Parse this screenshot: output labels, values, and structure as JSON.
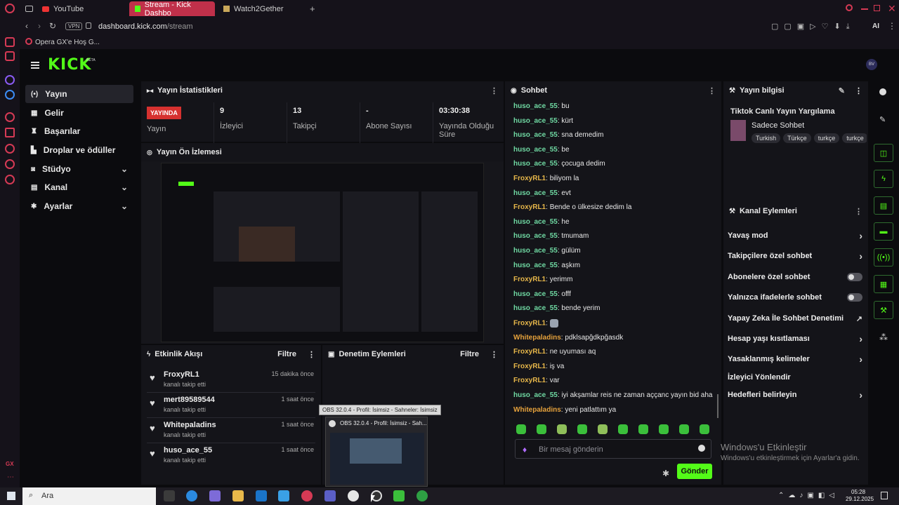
{
  "browser": {
    "tabs": [
      {
        "label": "YouTube",
        "active": false
      },
      {
        "label": "Stream - Kick Dashbo",
        "active": true
      },
      {
        "label": "Watch2Gether",
        "active": false
      }
    ],
    "vpn": "VPN",
    "url_domain": "dashboard.kick.com",
    "url_path": "/stream",
    "ai_label": "AI",
    "bookmark": "Opera GX'e Hoş G...",
    "gx_label": "GX"
  },
  "app": {
    "logo": "KICK",
    "logo_badge": "BETA",
    "avatar_label": "BV"
  },
  "sidebar": {
    "items": [
      {
        "label": "Yayın",
        "icon": "broadcast-icon",
        "active": true,
        "expandable": false
      },
      {
        "label": "Gelir",
        "icon": "revenue-icon",
        "active": false,
        "expandable": false
      },
      {
        "label": "Başarılar",
        "icon": "trophy-icon",
        "active": false,
        "expandable": false
      },
      {
        "label": "Droplar ve ödüller",
        "icon": "gift-icon",
        "active": false,
        "expandable": false
      },
      {
        "label": "Stüdyo",
        "icon": "studio-icon",
        "active": false,
        "expandable": true
      },
      {
        "label": "Kanal",
        "icon": "channel-icon",
        "active": false,
        "expandable": true
      },
      {
        "label": "Ayarlar",
        "icon": "gear-icon",
        "active": false,
        "expandable": true
      }
    ]
  },
  "stats": {
    "title": "Yayın İstatistikleri",
    "live_badge": "YAYINDA",
    "items": [
      {
        "value": "",
        "label": "Yayın"
      },
      {
        "value": "9",
        "label": "İzleyici"
      },
      {
        "value": "13",
        "label": "Takipçi"
      },
      {
        "value": "-",
        "label": "Abone Sayısı"
      },
      {
        "value": "03:30:38",
        "label": "Yayında Olduğu Süre"
      }
    ]
  },
  "preview": {
    "title": "Yayın Ön İzlemesi"
  },
  "events": {
    "title": "Etkinlik Akışı",
    "filter": "Filtre",
    "rows": [
      {
        "name": "FroxyRL1",
        "sub": "kanalı takip etti",
        "time": "15 dakika önce"
      },
      {
        "name": "mert89589544",
        "sub": "kanalı takip etti",
        "time": "1 saat önce"
      },
      {
        "name": "Whitepaladins",
        "sub": "kanalı takip etti",
        "time": "1 saat önce"
      },
      {
        "name": "huso_ace_55",
        "sub": "kanalı takip etti",
        "time": "1 saat önce"
      }
    ]
  },
  "moderation": {
    "title": "Denetim Eylemleri",
    "filter": "Filtre"
  },
  "obs": {
    "tooltip": "OBS 32.0.4 - Profil: İsimsiz - Sahneler: İsimsiz",
    "window_title": "OBS 32.0.4 - Profil: İsimsiz - Sah..."
  },
  "chat": {
    "title": "Sohbet",
    "messages": [
      {
        "user": "huso_ace_55",
        "text": "bu",
        "color": "green"
      },
      {
        "user": "huso_ace_55",
        "text": "kürt",
        "color": "green"
      },
      {
        "user": "huso_ace_55",
        "text": "sna demedim",
        "color": "green"
      },
      {
        "user": "huso_ace_55",
        "text": "be",
        "color": "green"
      },
      {
        "user": "huso_ace_55",
        "text": "çocuga dedim",
        "color": "green"
      },
      {
        "user": "FroxyRL1",
        "text": "biliyom la",
        "color": "yellow"
      },
      {
        "user": "huso_ace_55",
        "text": "evt",
        "color": "green"
      },
      {
        "user": "FroxyRL1",
        "text": "Bende o ülkesize dedim la",
        "color": "yellow"
      },
      {
        "user": "huso_ace_55",
        "text": "he",
        "color": "green"
      },
      {
        "user": "huso_ace_55",
        "text": "tmumam",
        "color": "green"
      },
      {
        "user": "huso_ace_55",
        "text": "gülüm",
        "color": "green"
      },
      {
        "user": "huso_ace_55",
        "text": "aşkım",
        "color": "green"
      },
      {
        "user": "FroxyRL1",
        "text": "yerimm",
        "color": "yellow"
      },
      {
        "user": "huso_ace_55",
        "text": "offf",
        "color": "green"
      },
      {
        "user": "huso_ace_55",
        "text": "bende yerim",
        "color": "green"
      },
      {
        "user": "FroxyRL1",
        "text": "",
        "color": "yellow"
      },
      {
        "user": "Whitepaladins",
        "text": "pdklsapğdkpğasdk",
        "color": "orange"
      },
      {
        "user": "FroxyRL1",
        "text": "ne uyuması aq",
        "color": "yellow"
      },
      {
        "user": "FroxyRL1",
        "text": "iş va",
        "color": "yellow"
      },
      {
        "user": "FroxyRL1",
        "text": "var",
        "color": "yellow"
      },
      {
        "user": "huso_ace_55",
        "text": "iyi akşamlar reis ne zaman aççanc yayın bid aha",
        "color": "green"
      },
      {
        "user": "Whitepaladins",
        "text": "yeni patlattım ya",
        "color": "orange"
      }
    ],
    "input_placeholder": "Bir mesaj gönderin",
    "send": "Gönder"
  },
  "info": {
    "title": "Yayın bilgisi",
    "stream_title": "Tiktok Canlı Yayın Yargılama",
    "category": "Sadece Sohbet",
    "tags": [
      "Turkish",
      "Türkçe",
      "turkçe",
      "turkçe"
    ]
  },
  "channel_actions": {
    "title": "Kanal Eylemleri",
    "items": [
      {
        "label": "Yavaş mod",
        "kind": "arrow"
      },
      {
        "label": "Takipçilere özel sohbet",
        "kind": "arrow"
      },
      {
        "label": "Abonelere özel sohbet",
        "kind": "toggle"
      },
      {
        "label": "Yalnızca ifadelerle sohbet",
        "kind": "toggle"
      },
      {
        "label": "Yapay Zeka İle Sohbet Denetimi",
        "kind": "external"
      },
      {
        "label": "Hesap yaşı kısıtlaması",
        "kind": "arrow"
      },
      {
        "label": "Yasaklanmış kelimeler",
        "kind": "arrow"
      },
      {
        "label": "İzleyici Yönlendir",
        "kind": "none"
      },
      {
        "label": "Hedefleri belirleyin",
        "kind": "arrow"
      }
    ]
  },
  "windows_watermark": {
    "line1": "Windows'u Etkinleştir",
    "line2": "Windows'u etkinleştirmek için Ayarlar'a gidin."
  },
  "taskbar": {
    "search_placeholder": "Ara",
    "time": "05:28",
    "date": "29.12.2025"
  },
  "colors": {
    "accent": "#53fc18",
    "live": "#d6312f",
    "opera": "#d63a55"
  }
}
